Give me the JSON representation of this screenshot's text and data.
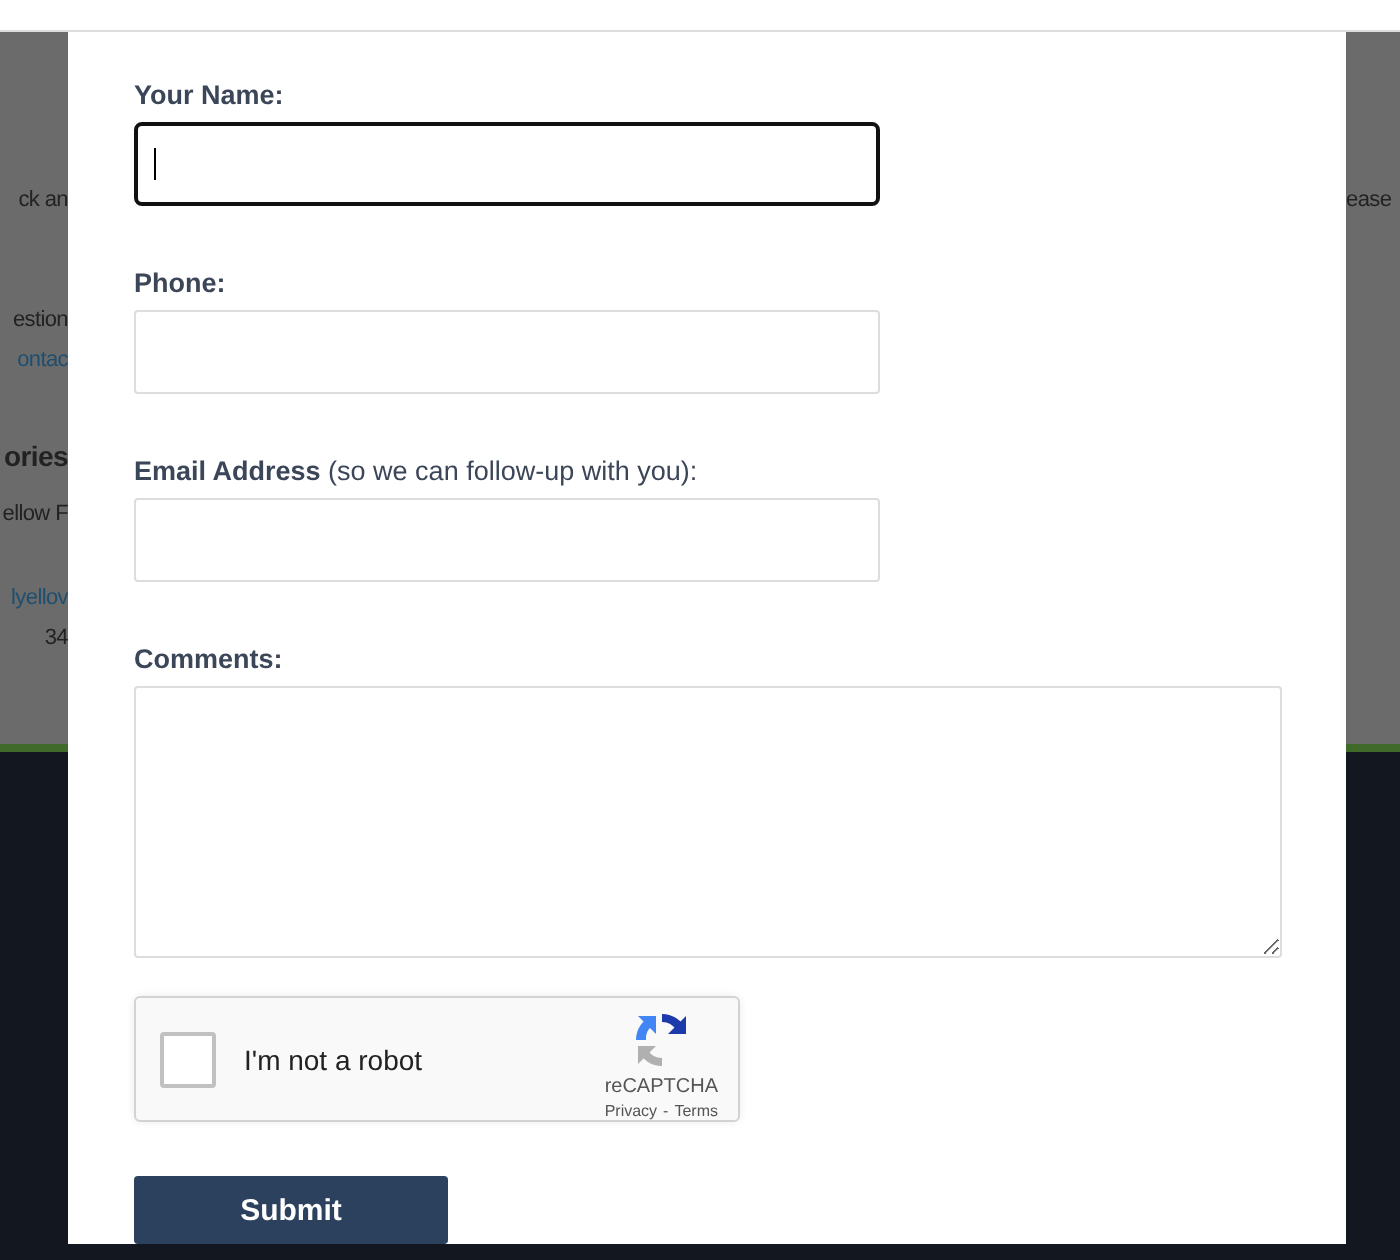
{
  "background": {
    "left_fragments": [
      {
        "text": "ck an",
        "kind": "text"
      },
      {
        "text": "estion",
        "kind": "text"
      },
      {
        "text": "ontac",
        "kind": "link"
      },
      {
        "text": "ories",
        "kind": "heading"
      },
      {
        "text": "ellow F",
        "kind": "text"
      },
      {
        "text": "lyellov",
        "kind": "link"
      },
      {
        "text": "34",
        "kind": "text"
      }
    ],
    "right_fragments": [
      {
        "text": "ease",
        "kind": "text"
      }
    ]
  },
  "form": {
    "fields": [
      {
        "kind": "input",
        "label": "Your Name:",
        "focused": true
      },
      {
        "kind": "input",
        "label": "Phone:",
        "focused": false
      },
      {
        "kind": "input",
        "label": "Email Address",
        "note": "(so we can follow-up with you):",
        "focused": false
      },
      {
        "kind": "textarea",
        "label": "Comments:",
        "focused": false
      }
    ],
    "captcha": {
      "label": "I'm not a robot",
      "checked": false,
      "brand": "reCAPTCHA",
      "privacy": "Privacy",
      "separator": "-",
      "terms": "Terms"
    },
    "submit": "Submit"
  }
}
